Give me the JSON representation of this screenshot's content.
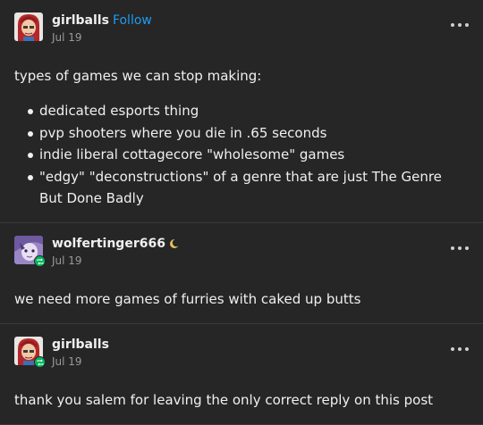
{
  "posts": [
    {
      "username": "girlballs",
      "follow_label": "Follow",
      "date": "Jul 19",
      "text": "types of games we can stop making:",
      "list": [
        "dedicated esports thing",
        "pvp shooters where you die in .65 seconds",
        "indie liberal cottagecore \"wholesome\" games",
        "\"edgy\" \"deconstructions\" of a genre that are just The Genre But Done Badly"
      ]
    },
    {
      "username": "wolfertinger666",
      "date": "Jul 19",
      "text": "we need more games of furries with caked up butts"
    },
    {
      "username": "girlballs",
      "date": "Jul 19",
      "text": "thank you salem for leaving the only correct reply on this post"
    }
  ],
  "colors": {
    "background": "#262626",
    "follow": "#1f9bf0",
    "reblog_badge": "#00b85c",
    "divider": "#3a3a3a"
  },
  "icons": [
    "more-options-icon",
    "reblog-icon",
    "moon-icon"
  ]
}
